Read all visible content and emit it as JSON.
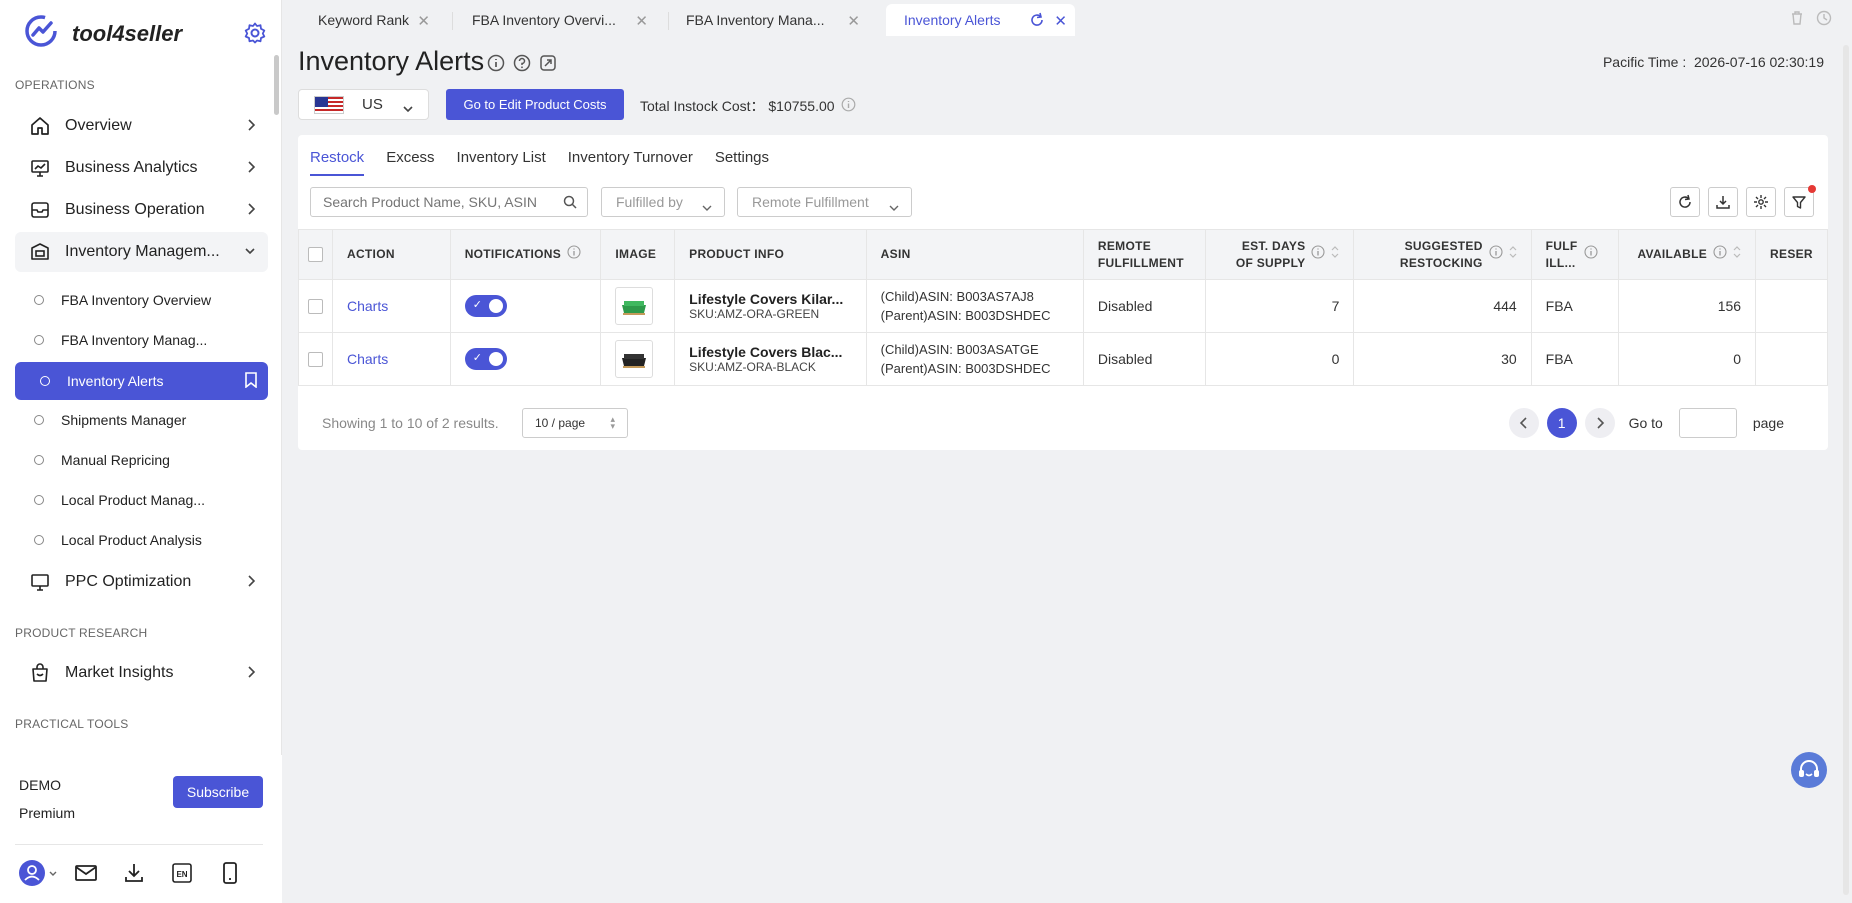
{
  "app": {
    "name": "tool4seller"
  },
  "sidebar": {
    "sections": {
      "operations": "OPERATIONS",
      "product_research": "PRODUCT RESEARCH",
      "practical_tools": "PRACTICAL TOOLS"
    },
    "items": [
      {
        "label": "Overview"
      },
      {
        "label": "Business Analytics"
      },
      {
        "label": "Business Operation"
      },
      {
        "label": "Inventory Managem..."
      },
      {
        "label": "PPC Optimization"
      },
      {
        "label": "Market Insights"
      }
    ],
    "sub_items": [
      {
        "label": "FBA Inventory Overview"
      },
      {
        "label": "FBA Inventory Manag..."
      },
      {
        "label": "Inventory Alerts"
      },
      {
        "label": "Shipments Manager"
      },
      {
        "label": "Manual Repricing"
      },
      {
        "label": "Local Product Manag..."
      },
      {
        "label": "Local Product Analysis"
      }
    ],
    "footer": {
      "demo": "DEMO",
      "plan": "Premium",
      "subscribe": "Subscribe"
    }
  },
  "tabs": [
    {
      "label": "Keyword Rank"
    },
    {
      "label": "FBA Inventory Overvi..."
    },
    {
      "label": "FBA Inventory Mana..."
    },
    {
      "label": "Inventory Alerts"
    }
  ],
  "header": {
    "title": "Inventory Alerts",
    "pacific_time": "Pacific Time :  2026-07-16 02:30:19",
    "country": "US",
    "edit_costs_button": "Go to Edit Product Costs",
    "instock_cost": "Total Instock Cost： $10755.00"
  },
  "subtabs": [
    {
      "label": "Restock"
    },
    {
      "label": "Excess"
    },
    {
      "label": "Inventory List"
    },
    {
      "label": "Inventory Turnover"
    },
    {
      "label": "Settings"
    }
  ],
  "filters": {
    "search_placeholder": "Search Product Name, SKU, ASIN",
    "fulfilled_by": "Fulfilled by",
    "remote_fulfillment": "Remote Fulfillment"
  },
  "table": {
    "columns": {
      "action": "ACTION",
      "notifications": "NOTIFICATIONS",
      "image": "IMAGE",
      "product_info": "PRODUCT INFO",
      "asin": "ASIN",
      "remote_1": "REMOTE",
      "remote_2": "FULFILLMENT",
      "est_1": "EST. DAYS",
      "est_2": "OF SUPPLY",
      "sugg_1": "SUGGESTED",
      "sugg_2": "RESTOCKING",
      "fulf_1": "FULF",
      "fulf_2": "ILL...",
      "available": "AVAILABLE",
      "reser": "RESER"
    },
    "rows": [
      {
        "action": "Charts",
        "notifications_on": true,
        "thumb_color": "#2e9a4a",
        "product_name": "Lifestyle Covers Kilar...",
        "sku": "SKU:AMZ-ORA-GREEN",
        "child_asin": "(Child)ASIN: B003AS7AJ8",
        "parent_asin": "(Parent)ASIN: B003DSHDEC",
        "remote": "Disabled",
        "est_days": "7",
        "suggested": "444",
        "fulfill": "FBA",
        "available": "156"
      },
      {
        "action": "Charts",
        "notifications_on": true,
        "thumb_color": "#222222",
        "product_name": "Lifestyle Covers Blac...",
        "sku": "SKU:AMZ-ORA-BLACK",
        "child_asin": "(Child)ASIN: B003ASATGE",
        "parent_asin": "(Parent)ASIN: B003DSHDEC",
        "remote": "Disabled",
        "est_days": "0",
        "suggested": "30",
        "fulfill": "FBA",
        "available": "0"
      }
    ]
  },
  "pagination": {
    "showing": "Showing 1 to 10 of 2 results.",
    "page_size": "10 / page",
    "current_page": "1",
    "goto_label": "Go to",
    "page_label": "page"
  },
  "colors": {
    "accent": "#4a55d6",
    "alert_dot": "#e53935"
  }
}
